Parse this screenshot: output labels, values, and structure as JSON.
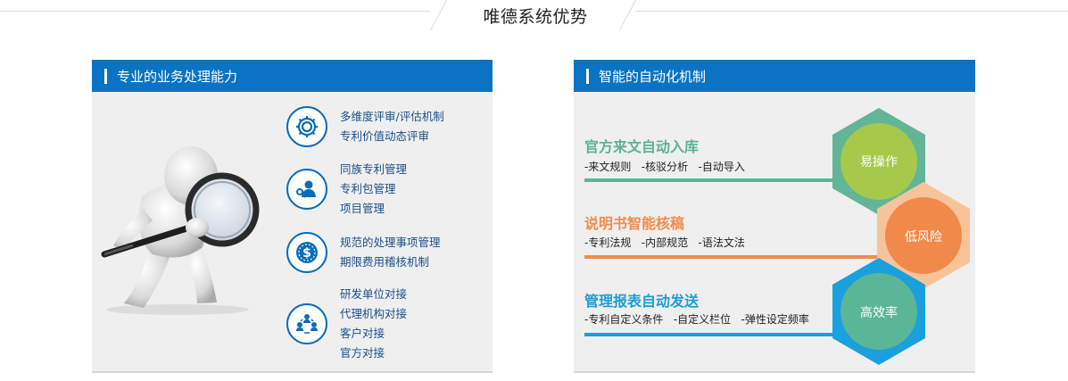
{
  "header": {
    "title": "唯德系统优势"
  },
  "left_panel": {
    "title": "专业的业务处理能力",
    "features": [
      {
        "icon": "gear-icon",
        "lines": [
          "多维度评审/评估机制",
          "专利价值动态评审"
        ]
      },
      {
        "icon": "user-key-icon",
        "lines": [
          "同族专利管理",
          "专利包管理",
          "项目管理"
        ]
      },
      {
        "icon": "dollar-coin-icon",
        "lines": [
          "规范的处理事项管理",
          "期限费用稽核机制"
        ]
      },
      {
        "icon": "people-group-icon",
        "lines": [
          "研发单位对接",
          "代理机构对接",
          "客户对接",
          "官方对接"
        ]
      }
    ]
  },
  "right_panel": {
    "title": "智能的自动化机制",
    "rows": [
      {
        "title": "官方来文自动入库",
        "subtitle": "-来文规则   -核驳分析   -自动导入",
        "color": "#5db392",
        "hex_label": "易操作",
        "hex_color": "#a6c94b",
        "hex_ring": "#62b596"
      },
      {
        "title": "说明书智能核稿",
        "subtitle": "-专利法规   -内部规范   -语法文法",
        "color": "#f08c4a",
        "hex_label": "低风险",
        "hex_color": "#f0894a",
        "hex_ring": "#f7c49a"
      },
      {
        "title": "管理报表自动发送",
        "subtitle": "-专利自定义条件   -自定义栏位   -弹性设定频率",
        "color": "#1a9ed8",
        "hex_label": "高效率",
        "hex_color": "#5bb597",
        "hex_ring": "#1aa0dc"
      }
    ]
  }
}
